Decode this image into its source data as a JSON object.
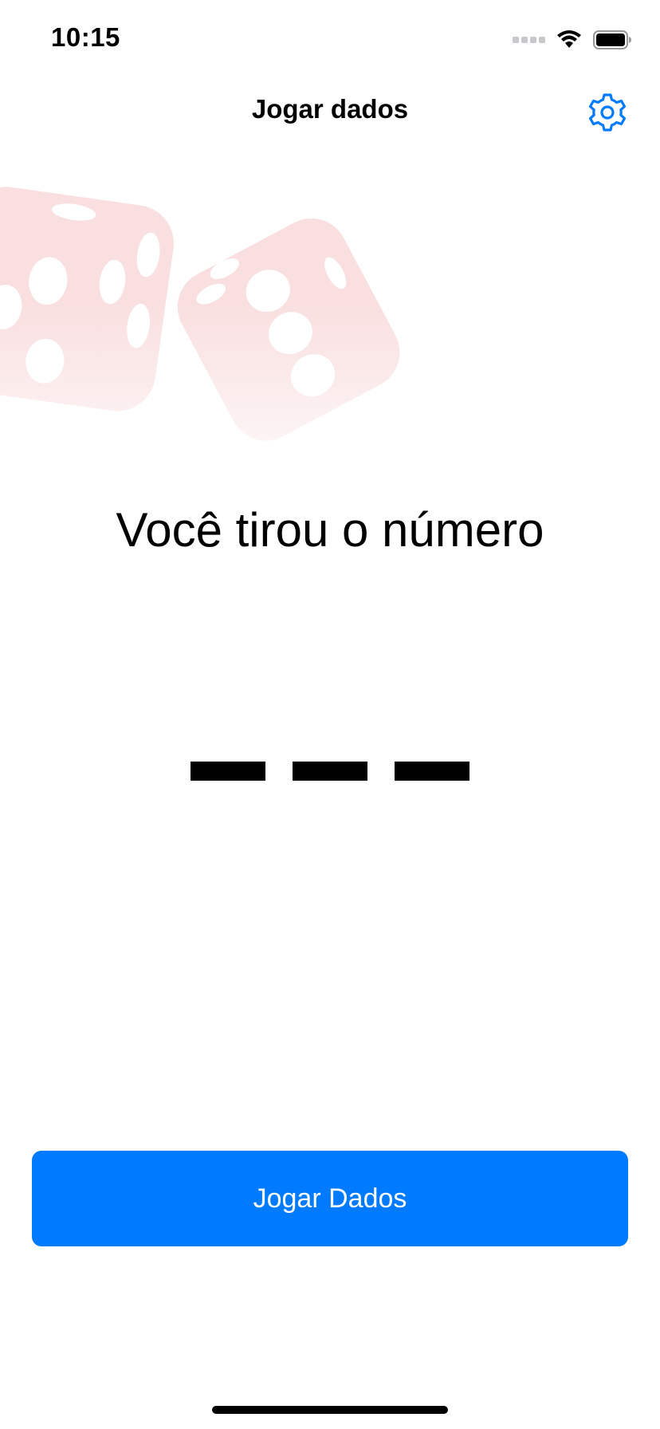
{
  "status_bar": {
    "time": "10:15",
    "icons": [
      "cellular-signal-icon",
      "wifi-icon",
      "battery-icon"
    ]
  },
  "nav": {
    "title": "Jogar dados",
    "settings_icon": "gear-icon"
  },
  "main": {
    "headline": "Você tirou o número",
    "number_placeholder": [
      "—",
      "—",
      "—"
    ]
  },
  "actions": {
    "roll_label": "Jogar Dados"
  },
  "colors": {
    "accent": "#007aff",
    "dice": "#d7282f"
  }
}
